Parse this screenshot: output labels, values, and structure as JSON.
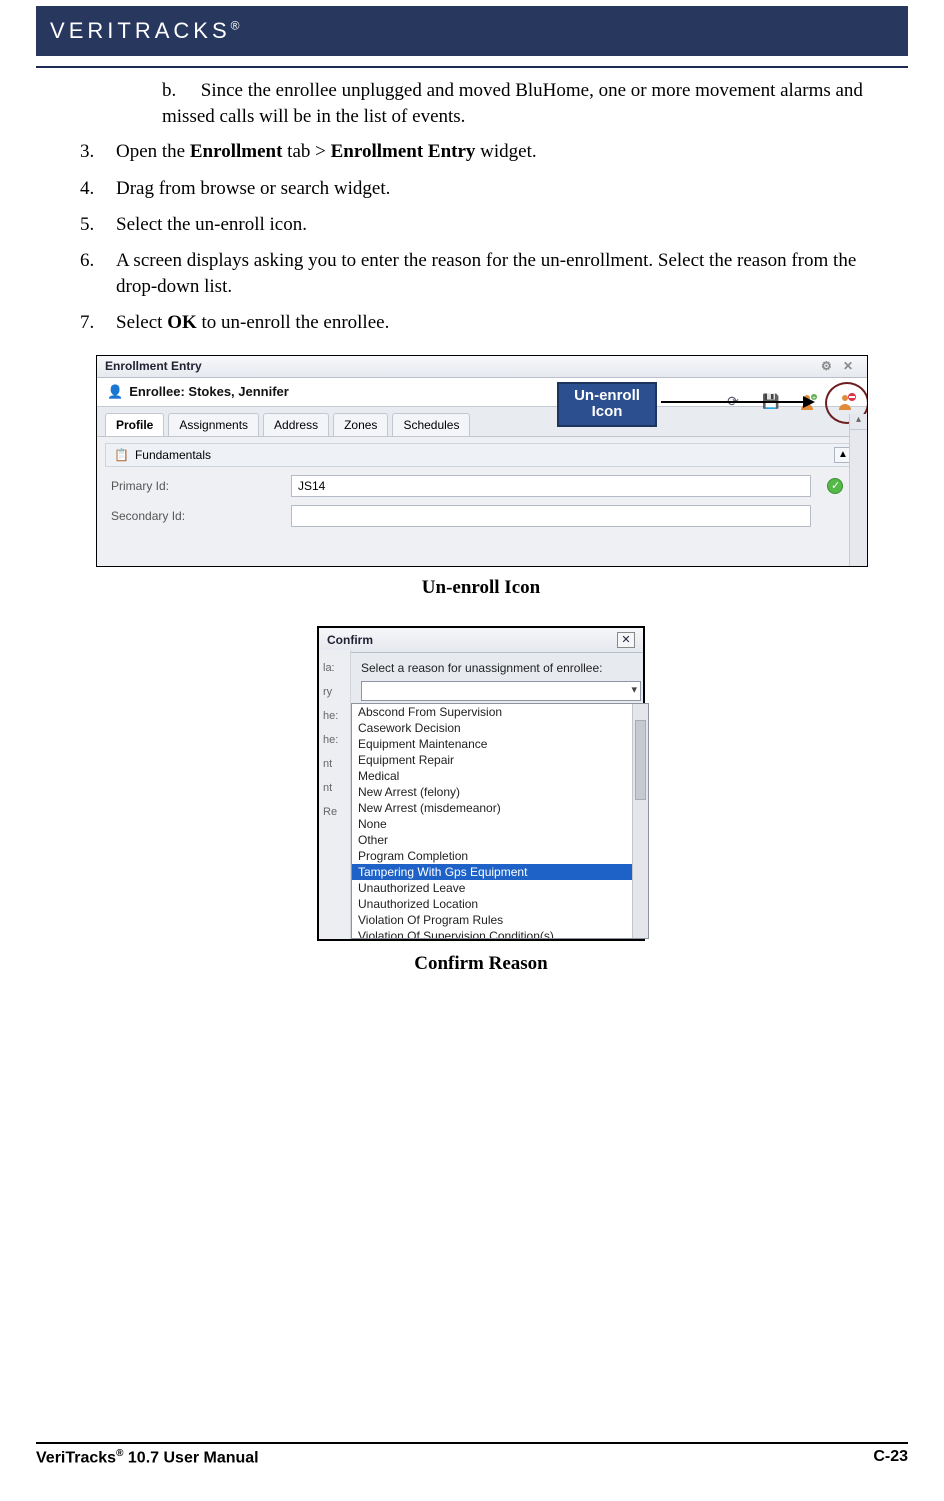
{
  "header": {
    "brand_start": "V",
    "brand_rest": "ERI",
    "brand_cap": "T",
    "brand_rest2": "RACKS",
    "reg": "®"
  },
  "text": {
    "b_label": "b.",
    "b_text": "Since the enrollee unplugged and moved BluHome, one or more movement alarms and missed calls will be in the list of events.",
    "s3_num": "3.",
    "s3_a": "Open the ",
    "s3_bold1": "Enrollment",
    "s3_b": " tab > ",
    "s3_bold2": "Enrollment Entry",
    "s3_c": " widget.",
    "s4_num": "4.",
    "s4": "Drag from browse or search widget.",
    "s5_num": "5.",
    "s5": "Select the un-enroll icon.",
    "s6_num": "6.",
    "s6": "A screen displays asking you to enter the reason for the un-enrollment. Select the reason from the drop-down list.",
    "s7_num": "7.",
    "s7_a": "Select ",
    "s7_bold": "OK",
    "s7_b": " to un-enroll the enrollee.",
    "fig1_caption": "Un-enroll Icon",
    "fig2_caption": "Confirm Reason"
  },
  "fig1": {
    "window_title": "Enrollment Entry",
    "panel_title": "Enrollee: Stokes, Jennifer",
    "tabs": [
      "Profile",
      "Assignments",
      "Address",
      "Zones",
      "Schedules"
    ],
    "active_tab": 0,
    "section": "Fundamentals",
    "fields": {
      "primary_label": "Primary Id:",
      "primary_value": "JS14",
      "secondary_label": "Secondary Id:",
      "secondary_value": ""
    },
    "callout_line1": "Un-enroll",
    "callout_line2": "Icon"
  },
  "fig2": {
    "title": "Confirm",
    "prompt": "Select a reason for unassignment of enrollee:",
    "options": [
      "Abscond From Supervision",
      "Casework Decision",
      "Equipment Maintenance",
      "Equipment Repair",
      "Medical",
      "New Arrest (felony)",
      "New Arrest (misdemeanor)",
      "None",
      "Other",
      "Program Completion",
      "Tampering With Gps Equipment",
      "Unauthorized Leave",
      "Unauthorized Location",
      "Violation Of Program Rules",
      "Violation Of Supervision Condition(s)"
    ],
    "selected_index": 10,
    "rail_labels": [
      "la:",
      "ry",
      "he:",
      "he:",
      "nt",
      "nt",
      "Re"
    ]
  },
  "footer": {
    "left_a": "VeriTracks",
    "left_reg": "®",
    "left_b": " 10.7 User Manual",
    "right": "C-23"
  }
}
